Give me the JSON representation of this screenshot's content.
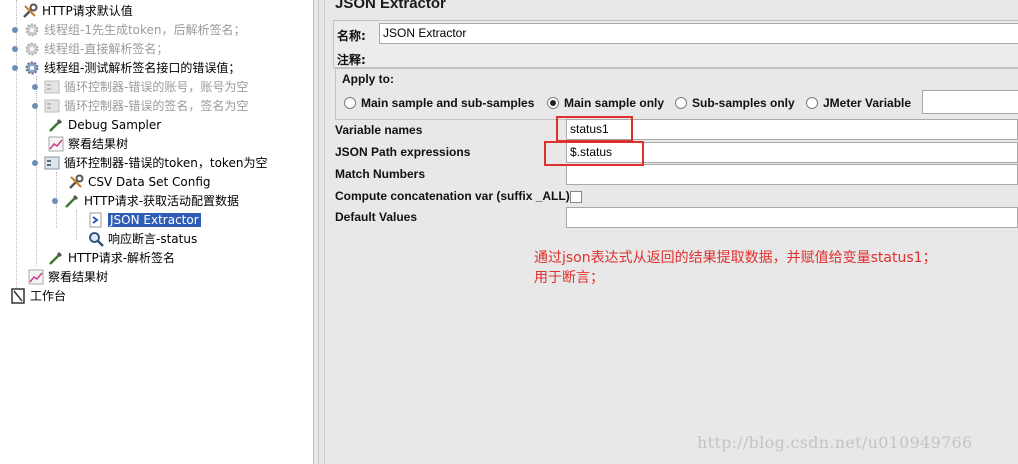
{
  "tree": {
    "nodes": [
      {
        "label": "HTTP请求默认值",
        "icon": "wrench-icon",
        "disabled": false,
        "selected": false
      },
      {
        "label": "线程组-1先生成token，后解析签名；",
        "icon": "gear-icon",
        "disabled": true,
        "selected": false
      },
      {
        "label": "线程组-直接解析签名；",
        "icon": "gear-icon",
        "disabled": true,
        "selected": false
      },
      {
        "label": "线程组-测试解析签名接口的错误值；",
        "icon": "gear-icon",
        "disabled": false,
        "selected": false
      },
      {
        "label": "循环控制器-错误的账号，账号为空",
        "icon": "loop-controller-icon",
        "disabled": true,
        "selected": false
      },
      {
        "label": "循环控制器-错误的签名，签名为空",
        "icon": "loop-controller-icon",
        "disabled": true,
        "selected": false
      },
      {
        "label": "Debug Sampler",
        "icon": "pipette-icon",
        "disabled": false,
        "selected": false
      },
      {
        "label": "察看结果树",
        "icon": "chart-icon",
        "disabled": false,
        "selected": false
      },
      {
        "label": "循环控制器-错误的token，token为空",
        "icon": "loop-controller-icon",
        "disabled": false,
        "selected": false
      },
      {
        "label": "CSV Data Set Config",
        "icon": "wrench-icon",
        "disabled": false,
        "selected": false
      },
      {
        "label": "HTTP请求-获取活动配置数据",
        "icon": "pipette-icon",
        "disabled": false,
        "selected": false
      },
      {
        "label": "JSON Extractor",
        "icon": "extractor-icon",
        "disabled": false,
        "selected": true
      },
      {
        "label": "响应断言-status",
        "icon": "magnifier-icon",
        "disabled": false,
        "selected": false
      },
      {
        "label": "HTTP请求-解析签名",
        "icon": "pipette-icon",
        "disabled": false,
        "selected": false
      },
      {
        "label": "察看结果树",
        "icon": "chart-icon",
        "disabled": false,
        "selected": false
      },
      {
        "label": "工作台",
        "icon": "workbench-icon",
        "disabled": false,
        "selected": false
      }
    ]
  },
  "panel": {
    "title": "JSON Extractor",
    "name_label": "名称:",
    "name_value": "JSON Extractor",
    "comment_label": "注释:",
    "comment_value": "",
    "apply_to": {
      "title": "Apply to:",
      "options": [
        "Main sample and sub-samples",
        "Main sample only",
        "Sub-samples only",
        "JMeter Variable"
      ],
      "selected": "Main sample only",
      "jmeter_variable_value": ""
    },
    "fields": {
      "variable_names_label": "Variable names",
      "variable_names_value": "status1",
      "json_path_label": "JSON Path expressions",
      "json_path_value": "$.status",
      "match_numbers_label": "Match Numbers",
      "match_numbers_value": "",
      "compute_concat_label": "Compute concatenation var (suffix _ALL)",
      "compute_concat_checked": false,
      "default_values_label": "Default Values",
      "default_values_value": ""
    },
    "annotation": {
      "line1": "通过json表达式从返回的结果提取数据，并赋值给变量status1；",
      "line2": "用于断言；"
    },
    "watermark": "http://blog.csdn.net/u010949766"
  },
  "colors": {
    "selection": "#2f5db6",
    "annotation_red": "#e0302d",
    "panel_bg": "#e8e8e8"
  }
}
